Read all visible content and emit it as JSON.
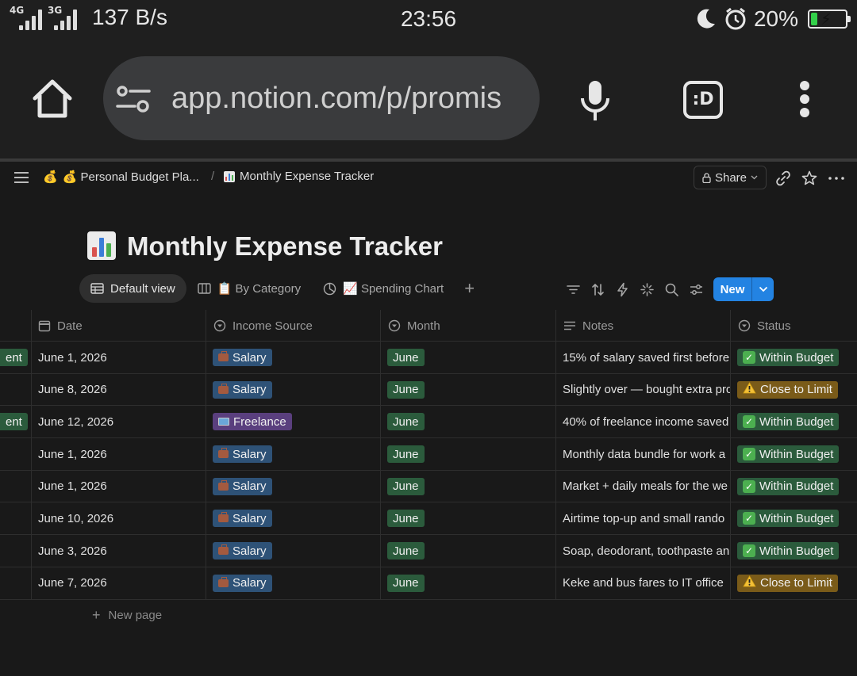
{
  "statusbar": {
    "net_label_1": "4G",
    "net_label_2": "3G",
    "speed": "137 B/s",
    "time": "23:56",
    "battery_pct": "20%",
    "battery_level": 0.2,
    "battery_color": "#33d04a"
  },
  "browser": {
    "url": "app.notion.com/p/promis",
    "d_button": ":D"
  },
  "topbar": {
    "crumb1_emoji": "💰",
    "crumb1_label": "💰 Personal Budget Pla...",
    "separator": "/",
    "crumb2_label": "Monthly Expense Tracker",
    "share_label": "Share"
  },
  "page": {
    "title": "Monthly Expense Tracker"
  },
  "views": {
    "tab1": "Default view",
    "tab2": "📋 By Category",
    "tab3": "📈 Spending Chart",
    "new_label": "New"
  },
  "table": {
    "headers": {
      "date": "Date",
      "income_source": "Income Source",
      "month": "Month",
      "notes": "Notes",
      "status": "Status"
    },
    "rows": [
      {
        "left": "ent",
        "date": "June 1, 2026",
        "source": "Salary",
        "month": "June",
        "notes": "15% of salary saved first before",
        "status": "Within Budget"
      },
      {
        "left": "",
        "date": "June 8, 2026",
        "source": "Salary",
        "month": "June",
        "notes": "Slightly over — bought extra pro",
        "status": "Close to Limit"
      },
      {
        "left": "ent",
        "date": "June 12, 2026",
        "source": "Freelance",
        "month": "June",
        "notes": "40% of freelance income saved",
        "status": "Within Budget"
      },
      {
        "left": "",
        "date": "June 1, 2026",
        "source": "Salary",
        "month": "June",
        "notes": "Monthly data bundle for work a",
        "status": "Within Budget"
      },
      {
        "left": "",
        "date": "June 1, 2026",
        "source": "Salary",
        "month": "June",
        "notes": "Market + daily meals for the we",
        "status": "Within Budget"
      },
      {
        "left": "",
        "date": "June 10, 2026",
        "source": "Salary",
        "month": "June",
        "notes": "Airtime top-up and small rando",
        "status": "Within Budget"
      },
      {
        "left": "",
        "date": "June 3, 2026",
        "source": "Salary",
        "month": "June",
        "notes": "Soap, deodorant, toothpaste an",
        "status": "Within Budget"
      },
      {
        "left": "",
        "date": "June 7, 2026",
        "source": "Salary",
        "month": "June",
        "notes": "Keke and bus fares to IT office",
        "status": "Close to Limit"
      }
    ],
    "new_page_label": "New page"
  },
  "colors": {
    "accent": "#2383e2",
    "tag_salary": "#2e5277",
    "tag_freelance": "#5a3f7e",
    "tag_month": "#2b5b3c",
    "tag_within": "#2b5b3c",
    "tag_close": "#7a5b19"
  }
}
